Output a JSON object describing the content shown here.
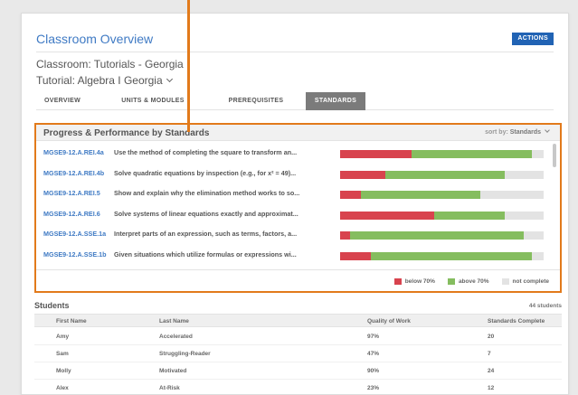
{
  "header": {
    "title": "Classroom Overview",
    "actions_label": "ACTIONS",
    "classroom": "Classroom: Tutorials - Georgia",
    "tutorial": "Tutorial: Algebra I Georgia"
  },
  "tabs": [
    {
      "label": "OVERVIEW",
      "active": false
    },
    {
      "label": "UNITS & MODULES",
      "active": false
    },
    {
      "label": "PREREQUISITES",
      "active": false
    },
    {
      "label": "STANDARDS",
      "active": true
    }
  ],
  "standards_panel": {
    "title": "Progress & Performance by Standards",
    "sort_label": "sort by:",
    "sort_value": "Standards",
    "rows": [
      {
        "code": "MGSE9-12.A.REI.4a",
        "description": "Use the method of completing the square to transform an...",
        "below_70": 35,
        "above_70": 59
      },
      {
        "code": "MGSE9-12.A.REI.4b",
        "description": "Solve quadratic equations by inspection (e.g., for x² = 49)...",
        "below_70": 22,
        "above_70": 59
      },
      {
        "code": "MGSE9-12.A.REI.5",
        "description": "Show and explain why the elimination method works to so...",
        "below_70": 10,
        "above_70": 59
      },
      {
        "code": "MGSE9-12.A.REI.6",
        "description": "Solve systems of linear equations exactly and approximat...",
        "below_70": 46,
        "above_70": 35
      },
      {
        "code": "MGSE9-12.A.SSE.1a",
        "description": "Interpret parts of an expression, such as terms, factors, a...",
        "below_70": 5,
        "above_70": 85
      },
      {
        "code": "MGSE9-12.A.SSE.1b",
        "description": "Given situations which utilize formulas or expressions wi...",
        "below_70": 15,
        "above_70": 79
      }
    ],
    "legend": [
      {
        "label": "below 70%",
        "color": "#d8434e"
      },
      {
        "label": "above 70%",
        "color": "#85bd5f"
      },
      {
        "label": "not complete",
        "color": "#e3e3e3"
      }
    ]
  },
  "students": {
    "title": "Students",
    "count": "44 students",
    "columns": [
      "First Name",
      "Last Name",
      "Quality of Work",
      "Standards Complete"
    ],
    "rows": [
      {
        "first": "Amy",
        "last": "Accelerated",
        "quality": "97%",
        "complete": "20"
      },
      {
        "first": "Sam",
        "last": "Struggling-Reader",
        "quality": "47%",
        "complete": "7"
      },
      {
        "first": "Molly",
        "last": "Motivated",
        "quality": "90%",
        "complete": "24"
      },
      {
        "first": "Alex",
        "last": "At-Risk",
        "quality": "23%",
        "complete": "12"
      }
    ]
  }
}
